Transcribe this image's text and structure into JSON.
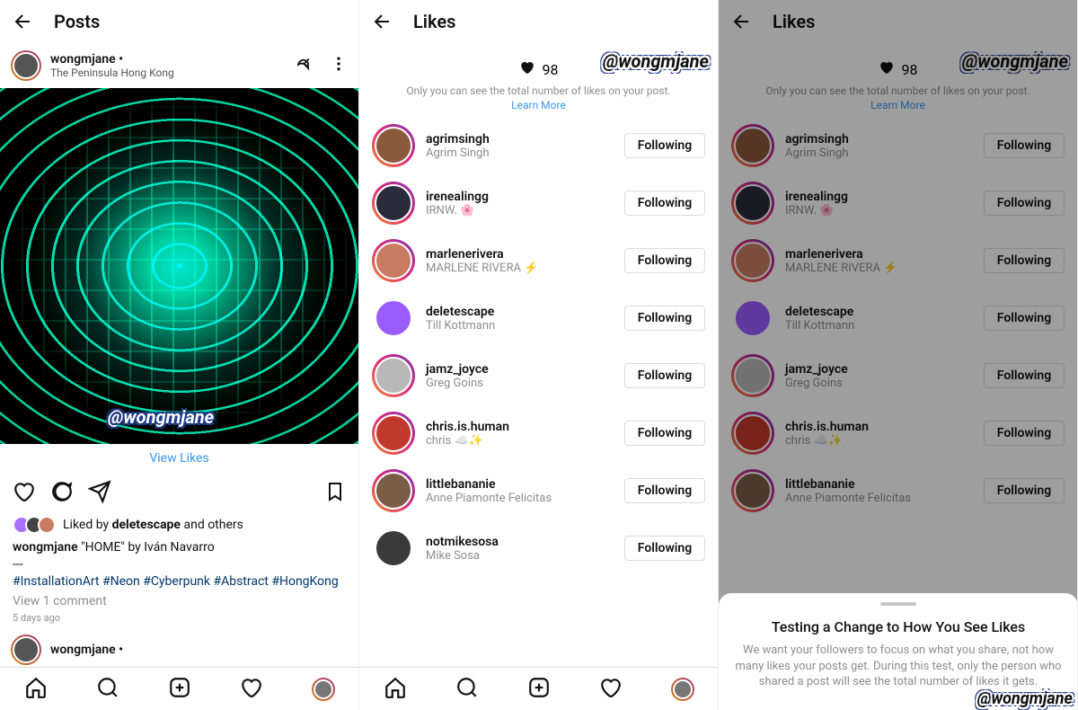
{
  "watermark": "@wongmjane",
  "panel1": {
    "header_title": "Posts",
    "post": {
      "username": "wongmjane •",
      "location": "The Peninsula Hong Kong",
      "view_likes": "View Likes",
      "liked_by_user": "deletescape",
      "liked_by_prefix": "Liked by ",
      "liked_by_suffix": " and others",
      "caption_user": "wongmjane",
      "caption_text": " \"HOME\" by Iván Navarro",
      "caption_sep": "---",
      "hashtags": "#InstallationArt #Neon #Cyberpunk #Abstract #HongKong",
      "view_comments": "View 1 comment",
      "timeago": "5 days ago"
    },
    "next_post_user": "wongmjane •"
  },
  "panel2": {
    "header_title": "Likes",
    "count": "98",
    "note": "Only you can see the total number of likes on your post.",
    "learn": "Learn More",
    "follow_label": "Following",
    "users": [
      {
        "u": "agrimsingh",
        "d": "Agrim Singh",
        "story": true,
        "c": "#8b5a3c"
      },
      {
        "u": "irenealingg",
        "d": "IRNW. 🌸",
        "story": true,
        "c": "#2b2b3b"
      },
      {
        "u": "marlenerivera",
        "d": "MARLENE RIVERA ⚡",
        "story": true,
        "c": "#c97b62"
      },
      {
        "u": "deletescape",
        "d": "Till Kottmann",
        "story": false,
        "c": "#9b5cff"
      },
      {
        "u": "jamz_joyce",
        "d": "Greg Goins",
        "story": true,
        "c": "#b8b8b8"
      },
      {
        "u": "chris.is.human",
        "d": "chris ☁️✨",
        "story": true,
        "c": "#c0392b"
      },
      {
        "u": "littlebananie",
        "d": "Anne Piamonte Felicitas",
        "story": true,
        "c": "#7a5d47"
      },
      {
        "u": "notmikesosa",
        "d": "Mike Sosa",
        "story": false,
        "c": "#3a3a3a"
      }
    ]
  },
  "panel3": {
    "header_title": "Likes",
    "sheet_title": "Testing a Change to How You See Likes",
    "sheet_body": "We want your followers to focus on what you share, not how many likes your posts get. During this test, only the person who shared a post will see the total number of likes it gets."
  }
}
